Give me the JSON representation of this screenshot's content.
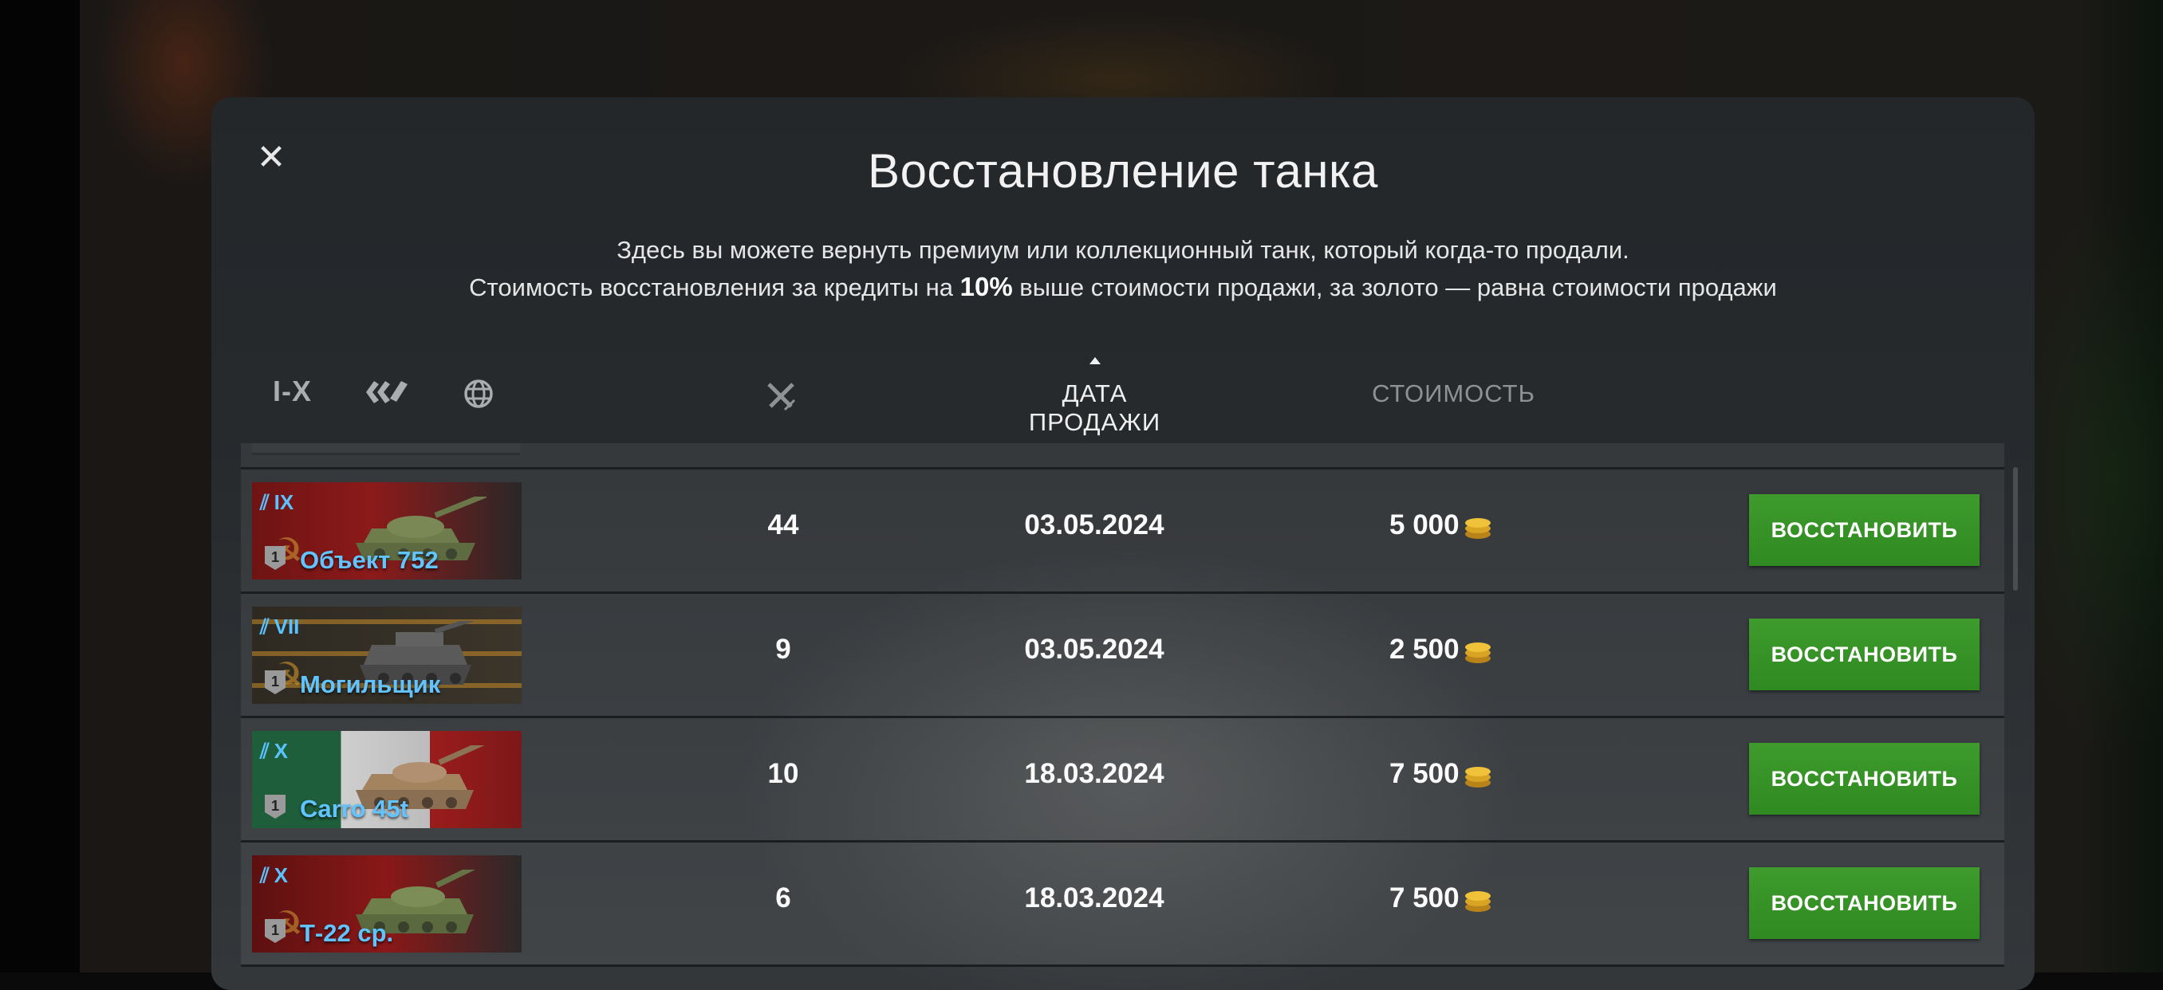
{
  "dialog": {
    "title": "Восстановление танка",
    "description_line1": "Здесь вы можете вернуть премиум или коллекционный танк, который когда-то продали.",
    "description_line2_pre": "Стоимость восстановления за кредиты на ",
    "description_line2_bold": "10%",
    "description_line2_post": " выше стоимости продажи, за золото — равна стоимости продажи",
    "close_icon": "close-icon"
  },
  "filters": {
    "tier_label": "I-X",
    "type_icon": "vehicle-type-icon",
    "nation_icon": "globe-icon"
  },
  "columns": {
    "battles_icon": "crossed-swords-icon",
    "sale_date": "ДАТА ПРОДАЖИ",
    "cost": "СТОИМОСТЬ",
    "sorted_by": "sale_date",
    "sort_direction": "ascending-arrow"
  },
  "rows": [
    {
      "tier": "IX",
      "name": "Объект 752",
      "battles": "44",
      "date": "03.05.2024",
      "cost": "5 000",
      "button": "ВОССТАНОВИТЬ"
    },
    {
      "tier": "VII",
      "name": "Могильщик",
      "battles": "9",
      "date": "03.05.2024",
      "cost": "2 500",
      "button": "ВОССТАНОВИТЬ"
    },
    {
      "tier": "X",
      "name": "Carro 45t",
      "battles": "10",
      "date": "18.03.2024",
      "cost": "7 500",
      "button": "ВОССТАНОВИТЬ"
    },
    {
      "tier": "X",
      "name": "Т-22 ср.",
      "battles": "6",
      "date": "18.03.2024",
      "cost": "7 500",
      "button": "ВОССТАНОВИТЬ"
    }
  ],
  "colors": {
    "accent_green": "#3e9b2c",
    "tank_name_blue": "#62c4ff",
    "coin_gold": "#e8b52a"
  }
}
